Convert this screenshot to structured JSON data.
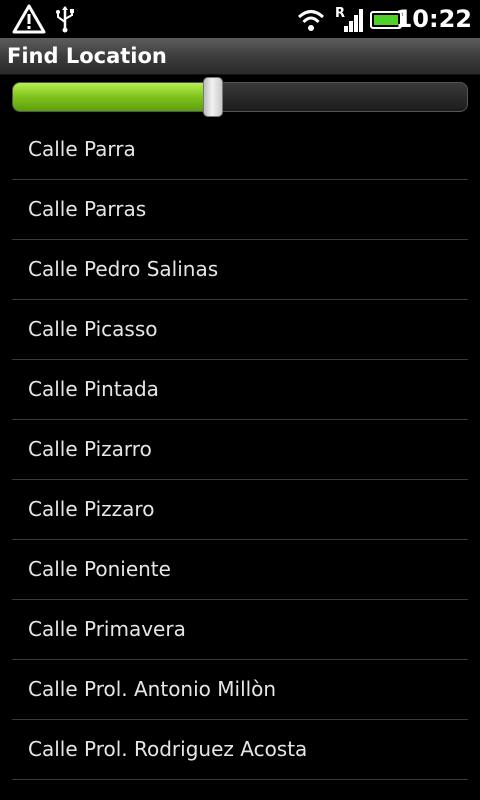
{
  "status_bar": {
    "icons": [
      "warning-icon",
      "usb-icon",
      "wifi-icon",
      "signal-icon",
      "roaming-icon",
      "battery-icon"
    ],
    "roaming_label": "R",
    "time": "10:22"
  },
  "header": {
    "title": "Find Location"
  },
  "slider": {
    "value_percent": 44,
    "fill_color": "#8ccc1e"
  },
  "locations": [
    "Calle Parra",
    "Calle Parras",
    "Calle Pedro Salinas",
    "Calle Picasso",
    "Calle Pintada",
    "Calle Pizarro",
    "Calle Pizzaro",
    "Calle Poniente",
    "Calle Primavera",
    "Calle Prol. Antonio Millòn",
    "Calle Prol. Rodriguez Acosta"
  ]
}
